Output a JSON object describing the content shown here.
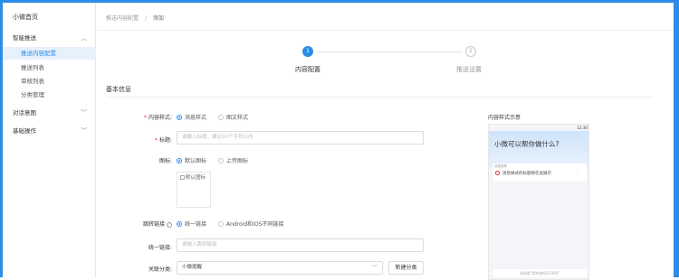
{
  "sidebar": {
    "title": "小微首页",
    "groups": [
      {
        "label": "智能推送",
        "chevron": "︿"
      },
      {
        "label": "对话意图",
        "chevron": "﹀"
      },
      {
        "label": "基础操作",
        "chevron": "﹀"
      }
    ],
    "items": [
      {
        "label": "推送内容配置",
        "active": true
      },
      {
        "label": "推送列表"
      },
      {
        "label": "审核列表"
      },
      {
        "label": "分类管理"
      }
    ]
  },
  "breadcrumb": {
    "parent": "推送内容配置",
    "separator": "/",
    "current": "添加"
  },
  "steps": [
    {
      "num": "1",
      "label": "内容配置"
    },
    {
      "num": "2",
      "label": "推送设置"
    }
  ],
  "section": {
    "title": "基本信息"
  },
  "form": {
    "content_style": {
      "label": "内容样式:",
      "options": [
        "消息样式",
        "图文样式"
      ]
    },
    "title": {
      "label": "标题:",
      "placeholder": "请输入标题，建议20个字符以内"
    },
    "icon": {
      "label": "图标:",
      "options": [
        "默认图标",
        "上传图标"
      ],
      "img_alt": "默认图标"
    },
    "link": {
      "label": "跳转链接",
      "help": "?",
      "options": [
        "统一链接",
        "Android和iOS不同链接"
      ]
    },
    "unified_link": {
      "label": "统一链接:",
      "placeholder": "请输入跳转链接"
    },
    "category": {
      "label": "关联分类:",
      "value": "小微提醒",
      "arrow": "﹀",
      "new_button": "新建分类"
    }
  },
  "preview": {
    "title": "内容样式示意",
    "status_time": "12:30",
    "question": "小微可以帮你做什么?",
    "card_caption": "消息推荐",
    "item_text": "消息样式的标题将在此展示",
    "item_arrow": "›",
    "input_hint": "说说看\"我的借呗10345\""
  },
  "colors": {
    "accent": "#2b8de8",
    "required": "#e2352b"
  }
}
